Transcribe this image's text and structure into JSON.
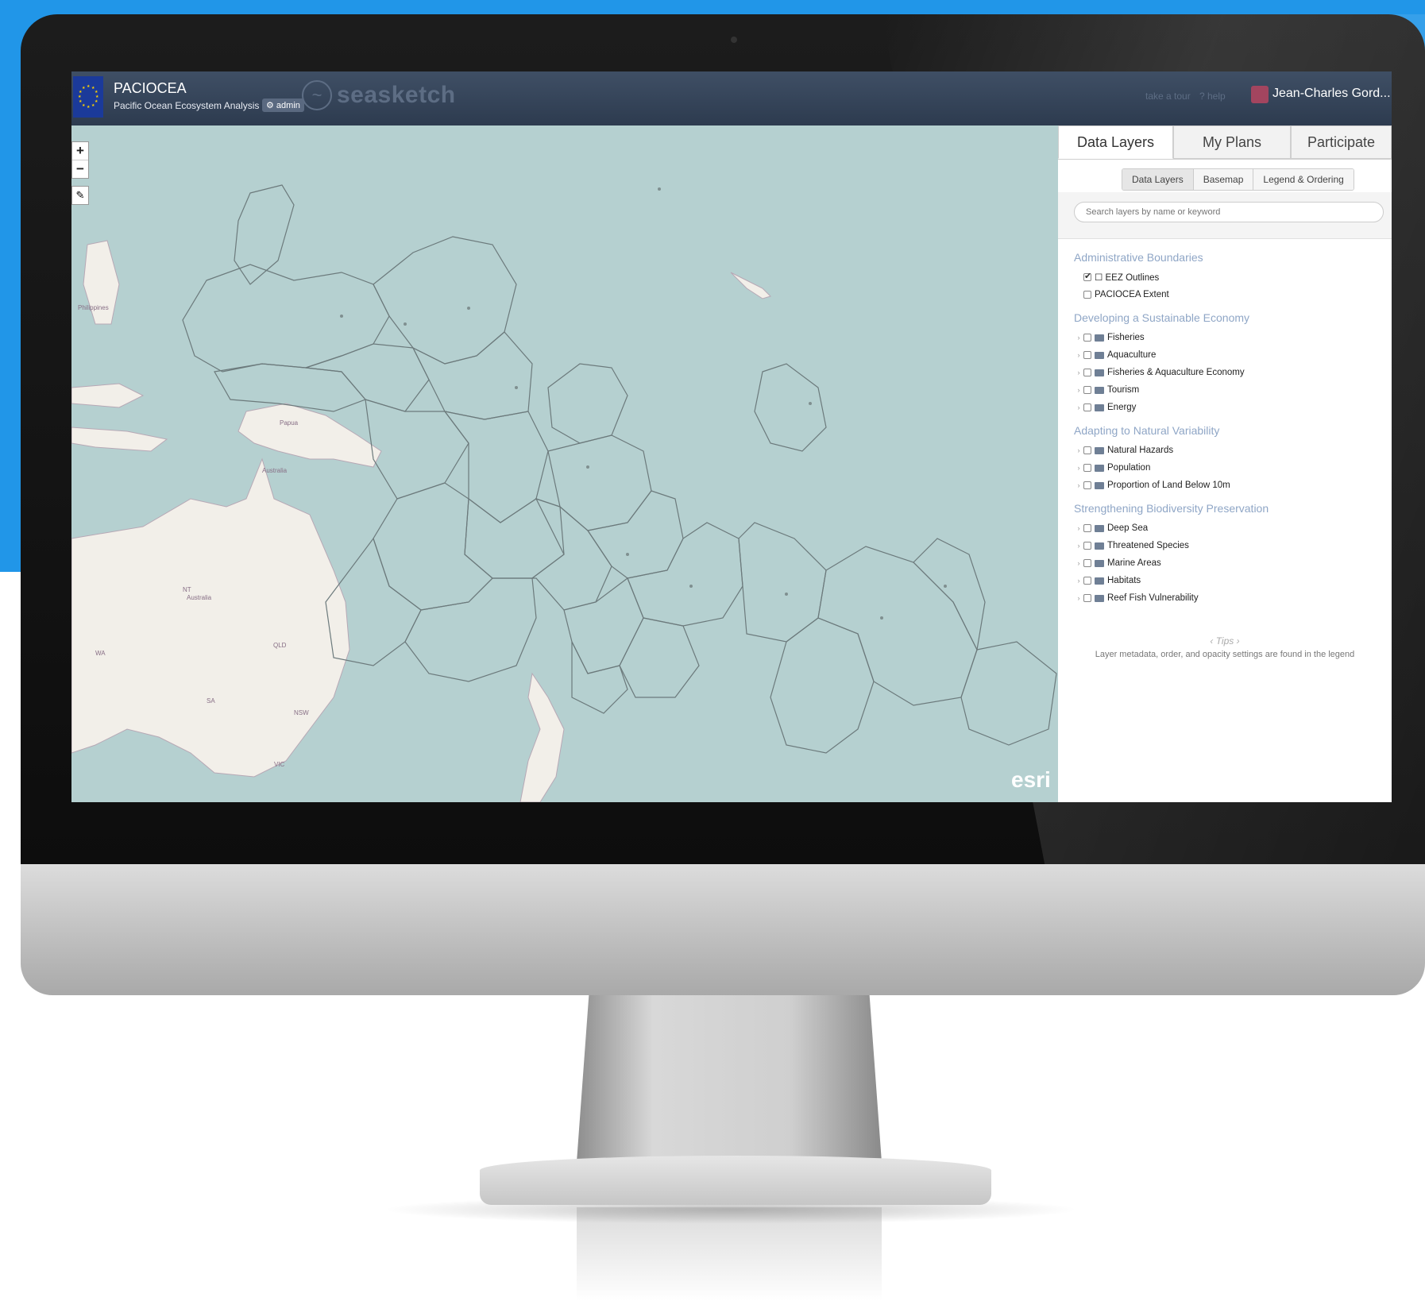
{
  "header": {
    "title": "PACIOCEA",
    "subtitle": "Pacific Ocean Ecosystem Analysis",
    "admin_badge": "⚙ admin",
    "brand": "seasketch",
    "tour": "take a tour",
    "help": "? help",
    "user": "Jean-Charles Gord..."
  },
  "map": {
    "zoom_in": "+",
    "zoom_out": "−",
    "tools_icon": "wrench-icon",
    "attribution": "esri",
    "labels": {
      "australia": "Australia",
      "nt": "NT",
      "qld": "QLD",
      "wa": "WA",
      "sa": "SA",
      "nsw": "NSW",
      "vic": "VIC",
      "philippines": "Philippines",
      "papua": "Papua"
    }
  },
  "panel": {
    "tabs": [
      "Data Layers",
      "My Plans",
      "Participate"
    ],
    "subtabs": [
      "Data Layers",
      "Basemap",
      "Legend & Ordering"
    ],
    "search_placeholder": "Search layers by name or keyword",
    "groups": [
      {
        "title": "Administrative Boundaries",
        "layers": [
          {
            "label": "☐ EEZ Outlines",
            "checked": true,
            "folder": false
          },
          {
            "label": "PACIOCEA Extent",
            "checked": false,
            "folder": false
          }
        ]
      },
      {
        "title": "Developing a Sustainable Economy",
        "layers": [
          {
            "label": "Fisheries",
            "folder": true
          },
          {
            "label": "Aquaculture",
            "folder": true
          },
          {
            "label": "Fisheries & Aquaculture Economy",
            "folder": true
          },
          {
            "label": "Tourism",
            "folder": true
          },
          {
            "label": "Energy",
            "folder": true
          }
        ]
      },
      {
        "title": "Adapting to Natural Variability",
        "layers": [
          {
            "label": "Natural Hazards",
            "folder": true
          },
          {
            "label": "Population",
            "folder": true
          },
          {
            "label": "Proportion of Land Below 10m",
            "folder": true
          }
        ]
      },
      {
        "title": "Strengthening Biodiversity Preservation",
        "layers": [
          {
            "label": "Deep Sea",
            "folder": true
          },
          {
            "label": "Threatened Species",
            "folder": true
          },
          {
            "label": "Marine Areas",
            "folder": true
          },
          {
            "label": "Habitats",
            "folder": true
          },
          {
            "label": "Reef Fish Vulnerability",
            "folder": true
          }
        ]
      }
    ],
    "tips_nav": "‹ Tips ›",
    "tips_text": "Layer metadata, order, and opacity settings are found in the legend"
  },
  "colors": {
    "accent_blue": "#2196e8",
    "topbar": "#34445a",
    "ocean": "#b5d0d0",
    "land": "#f2efe9",
    "group_title": "#8fa6c6"
  }
}
